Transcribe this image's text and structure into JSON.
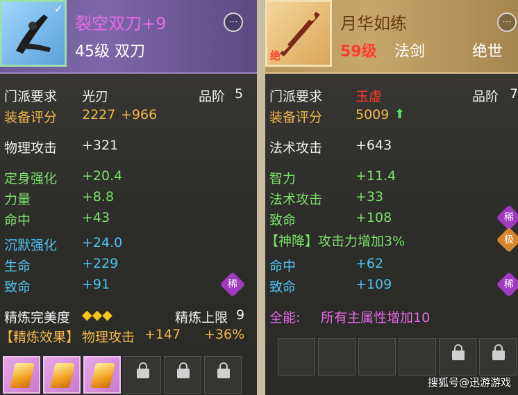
{
  "left": {
    "title": "裂空双刀+9",
    "subtitle": "45级 双刀",
    "rows": {
      "sect": {
        "label": "门派要求",
        "value": "光刃"
      },
      "grade": {
        "label": "品阶",
        "value": "5"
      },
      "score": {
        "label": "装备评分",
        "value": "2227",
        "bonus": "+966"
      },
      "phys": {
        "label": "物理攻击",
        "value": "+321"
      },
      "fix": {
        "label": "定身强化",
        "value": "+20.4"
      },
      "power": {
        "label": "力量",
        "value": "+8.8"
      },
      "hit": {
        "label": "命中",
        "value": "+43"
      },
      "silence": {
        "label": "沉默强化",
        "value": "+24.0"
      },
      "life": {
        "label": "生命",
        "value": "+229"
      },
      "crit": {
        "label": "致命",
        "value": "+91"
      },
      "refine": {
        "label": "精炼完美度",
        "stars": "◆◆◆",
        "cap_label": "精炼上限",
        "cap": "9"
      },
      "effect": {
        "label": "【精炼效果】",
        "stat": "物理攻击",
        "value": "+147",
        "pct": "+36%"
      }
    },
    "badge": "稀"
  },
  "right": {
    "title": "月华如练",
    "level": "59级",
    "type": "法剑",
    "tier": "绝世",
    "icon_tag": "绝",
    "rows": {
      "sect": {
        "label": "门派要求",
        "value": "玉虚"
      },
      "grade": {
        "label": "品阶",
        "value": "7"
      },
      "score": {
        "label": "装备评分",
        "value": "5009"
      },
      "magic": {
        "label": "法术攻击",
        "value": "+643"
      },
      "int": {
        "label": "智力",
        "value": "+11.4"
      },
      "magic2": {
        "label": "法术攻击",
        "value": "+33"
      },
      "crit": {
        "label": "致命",
        "value": "+108"
      },
      "divine": {
        "text": "【神降】攻击力增加3%"
      },
      "hit": {
        "label": "命中",
        "value": "+62"
      },
      "crit2": {
        "label": "致命",
        "value": "+109"
      },
      "allround": {
        "label": "全能:",
        "value": "所有主属性增加10"
      }
    },
    "badge1": "稀",
    "badge2": "极",
    "badge3": "稀"
  },
  "more_label": "···",
  "watermark": "搜狐号@迅游游戏",
  "colors": {
    "white": "#f0f0f0",
    "orange": "#f2b84a",
    "green": "#7be06a",
    "blue": "#4fc3f0",
    "pink": "#e86ae8",
    "red": "#ff3b30"
  }
}
